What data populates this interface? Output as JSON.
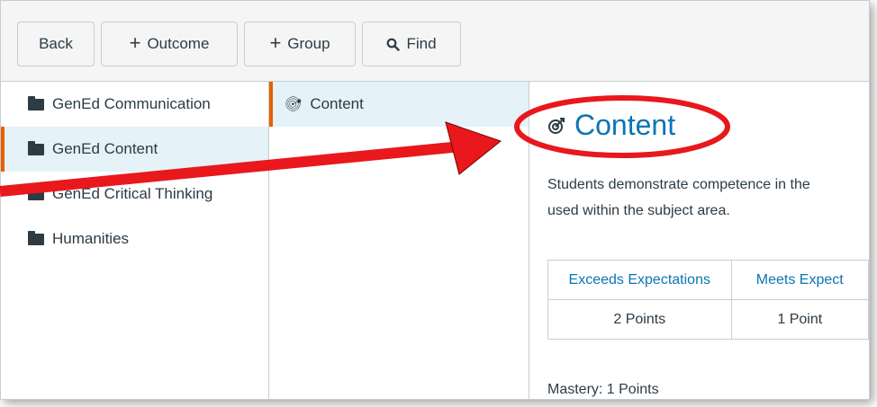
{
  "toolbar": {
    "back_label": "Back",
    "add_outcome_label": "Outcome",
    "add_group_label": "Group",
    "find_label": "Find",
    "plus_icon": "plus-icon",
    "search_icon": "search-icon"
  },
  "groups": [
    {
      "label": "GenEd Communication",
      "selected": false
    },
    {
      "label": "GenEd Content",
      "selected": true
    },
    {
      "label": "GenEd Critical Thinking",
      "selected": false
    },
    {
      "label": "Humanities",
      "selected": false
    }
  ],
  "outcomes": [
    {
      "label": "Content",
      "selected": true
    }
  ],
  "detail": {
    "title": "Content",
    "description_line1": "Students demonstrate competence in the",
    "description_line2": "used within the subject area.",
    "ratings": [
      {
        "title": "Exceeds Expectations",
        "points": "2 Points"
      },
      {
        "title": "Meets Expect",
        "points": "1 Point"
      }
    ],
    "mastery": "Mastery: 1 Points"
  },
  "colors": {
    "accent": "#e66000",
    "link": "#0b75b4",
    "selected_bg": "#e5f2f8",
    "annotation": "#e8181d"
  }
}
